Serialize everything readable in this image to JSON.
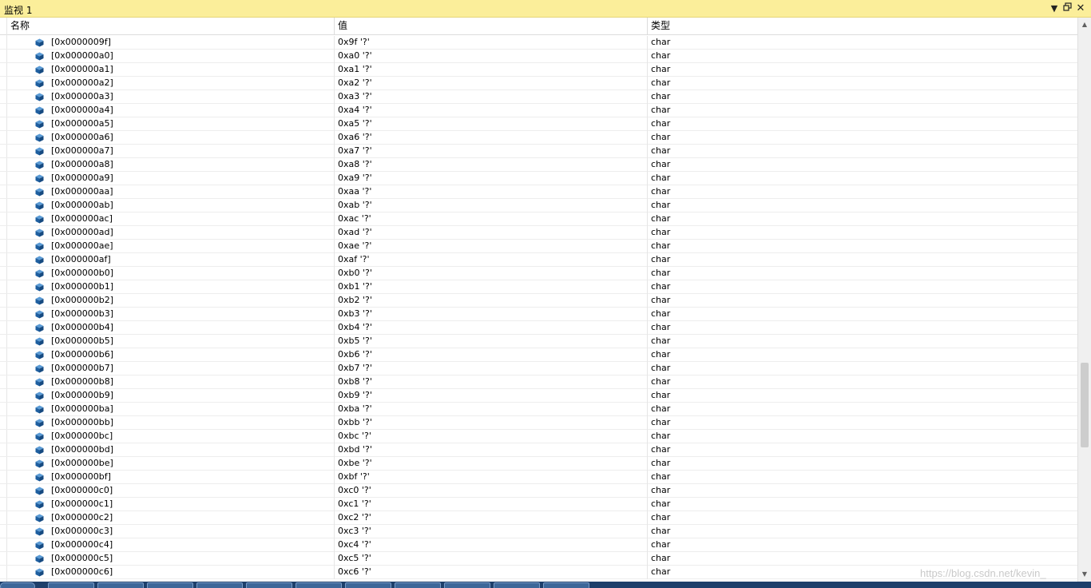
{
  "window": {
    "title": "监视 1",
    "menu_icon": "dropdown-arrow-icon",
    "restore_icon": "restore-window-icon",
    "close_icon": "close-icon"
  },
  "columns": {
    "name": "名称",
    "value": "值",
    "type": "类型"
  },
  "rows": [
    {
      "name": "[0x0000009f]",
      "value": "0x9f '?'",
      "type": "char"
    },
    {
      "name": "[0x000000a0]",
      "value": "0xa0 '?'",
      "type": "char"
    },
    {
      "name": "[0x000000a1]",
      "value": "0xa1 '?'",
      "type": "char"
    },
    {
      "name": "[0x000000a2]",
      "value": "0xa2 '?'",
      "type": "char"
    },
    {
      "name": "[0x000000a3]",
      "value": "0xa3 '?'",
      "type": "char"
    },
    {
      "name": "[0x000000a4]",
      "value": "0xa4 '?'",
      "type": "char"
    },
    {
      "name": "[0x000000a5]",
      "value": "0xa5 '?'",
      "type": "char"
    },
    {
      "name": "[0x000000a6]",
      "value": "0xa6 '?'",
      "type": "char"
    },
    {
      "name": "[0x000000a7]",
      "value": "0xa7 '?'",
      "type": "char"
    },
    {
      "name": "[0x000000a8]",
      "value": "0xa8 '?'",
      "type": "char"
    },
    {
      "name": "[0x000000a9]",
      "value": "0xa9 '?'",
      "type": "char"
    },
    {
      "name": "[0x000000aa]",
      "value": "0xaa '?'",
      "type": "char"
    },
    {
      "name": "[0x000000ab]",
      "value": "0xab '?'",
      "type": "char"
    },
    {
      "name": "[0x000000ac]",
      "value": "0xac '?'",
      "type": "char"
    },
    {
      "name": "[0x000000ad]",
      "value": "0xad '?'",
      "type": "char"
    },
    {
      "name": "[0x000000ae]",
      "value": "0xae '?'",
      "type": "char"
    },
    {
      "name": "[0x000000af]",
      "value": "0xaf '?'",
      "type": "char"
    },
    {
      "name": "[0x000000b0]",
      "value": "0xb0 '?'",
      "type": "char"
    },
    {
      "name": "[0x000000b1]",
      "value": "0xb1 '?'",
      "type": "char"
    },
    {
      "name": "[0x000000b2]",
      "value": "0xb2 '?'",
      "type": "char"
    },
    {
      "name": "[0x000000b3]",
      "value": "0xb3 '?'",
      "type": "char"
    },
    {
      "name": "[0x000000b4]",
      "value": "0xb4 '?'",
      "type": "char"
    },
    {
      "name": "[0x000000b5]",
      "value": "0xb5 '?'",
      "type": "char"
    },
    {
      "name": "[0x000000b6]",
      "value": "0xb6 '?'",
      "type": "char"
    },
    {
      "name": "[0x000000b7]",
      "value": "0xb7 '?'",
      "type": "char"
    },
    {
      "name": "[0x000000b8]",
      "value": "0xb8 '?'",
      "type": "char"
    },
    {
      "name": "[0x000000b9]",
      "value": "0xb9 '?'",
      "type": "char"
    },
    {
      "name": "[0x000000ba]",
      "value": "0xba '?'",
      "type": "char"
    },
    {
      "name": "[0x000000bb]",
      "value": "0xbb '?'",
      "type": "char"
    },
    {
      "name": "[0x000000bc]",
      "value": "0xbc '?'",
      "type": "char"
    },
    {
      "name": "[0x000000bd]",
      "value": "0xbd '?'",
      "type": "char"
    },
    {
      "name": "[0x000000be]",
      "value": "0xbe '?'",
      "type": "char"
    },
    {
      "name": "[0x000000bf]",
      "value": "0xbf '?'",
      "type": "char"
    },
    {
      "name": "[0x000000c0]",
      "value": "0xc0 '?'",
      "type": "char"
    },
    {
      "name": "[0x000000c1]",
      "value": "0xc1 '?'",
      "type": "char"
    },
    {
      "name": "[0x000000c2]",
      "value": "0xc2 '?'",
      "type": "char"
    },
    {
      "name": "[0x000000c3]",
      "value": "0xc3 '?'",
      "type": "char"
    },
    {
      "name": "[0x000000c4]",
      "value": "0xc4 '?'",
      "type": "char"
    },
    {
      "name": "[0x000000c5]",
      "value": "0xc5 '?'",
      "type": "char"
    },
    {
      "name": "[0x000000c6]",
      "value": "0xc6 '?'",
      "type": "char"
    }
  ],
  "row_icon": "variable-cube-icon",
  "colors": {
    "titlebar": "#fbee9a",
    "icon": "#1e5fa0",
    "taskbar": "#1d3f6b"
  },
  "watermark": "https://blog.csdn.net/kevin_"
}
